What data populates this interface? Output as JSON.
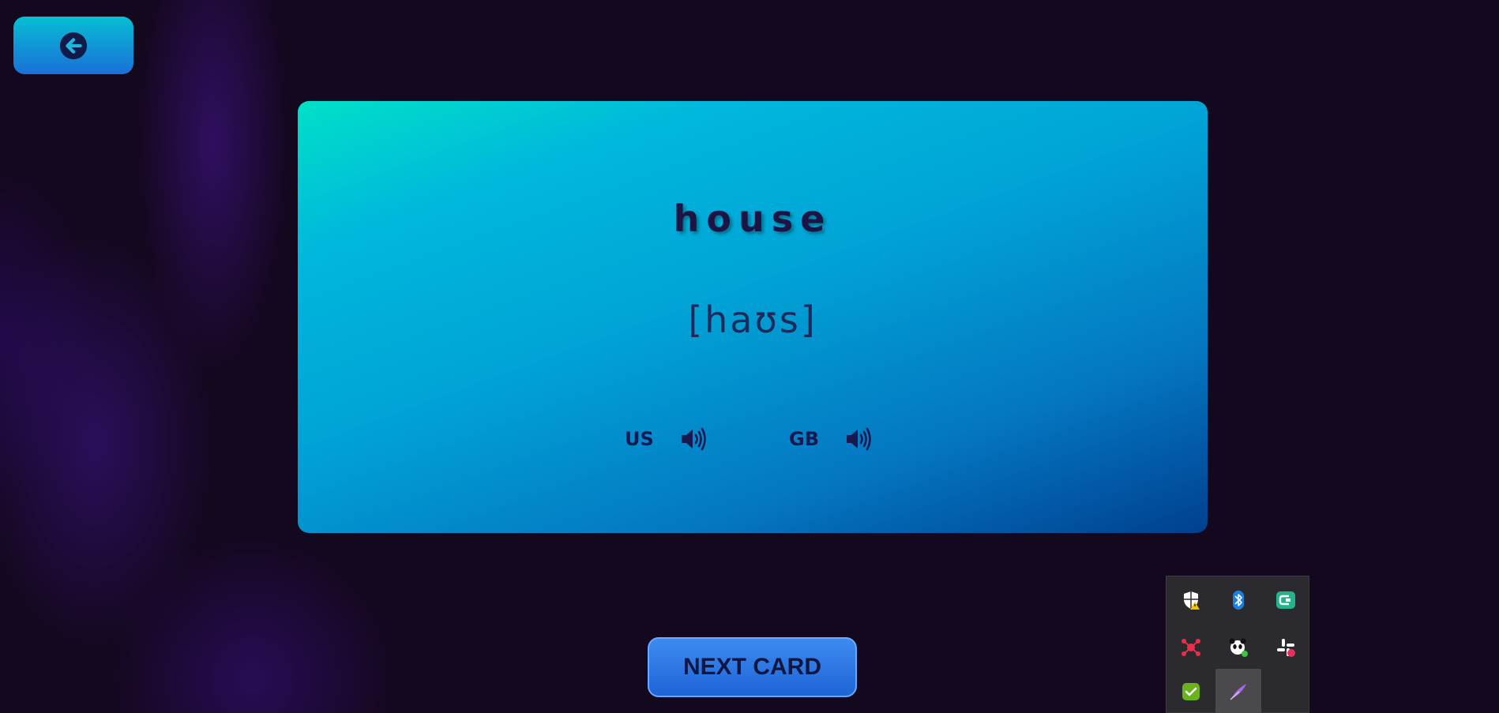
{
  "flashcard": {
    "word": "house",
    "phonetic": "[haʊs]",
    "pronunciations": [
      {
        "label": "US",
        "icon": "speaker-icon"
      },
      {
        "label": "GB",
        "icon": "speaker-icon"
      }
    ]
  },
  "navigation": {
    "back_icon": "arrow-left-icon",
    "next_label": "NEXT CARD"
  },
  "tray": {
    "icons": [
      {
        "name": "windows-security-warning-icon"
      },
      {
        "name": "bluetooth-icon"
      },
      {
        "name": "green-app-icon"
      },
      {
        "name": "red-network-app-icon"
      },
      {
        "name": "panda-app-icon"
      },
      {
        "name": "slack-icon"
      },
      {
        "name": "green-check-app-icon"
      },
      {
        "name": "feather-pen-app-icon"
      }
    ]
  },
  "colors": {
    "card_gradient_start": "#00e0c8",
    "card_gradient_end": "#00408f",
    "word_color": "#1b1445",
    "next_button": "#1e64d6",
    "background": "#14081f"
  }
}
